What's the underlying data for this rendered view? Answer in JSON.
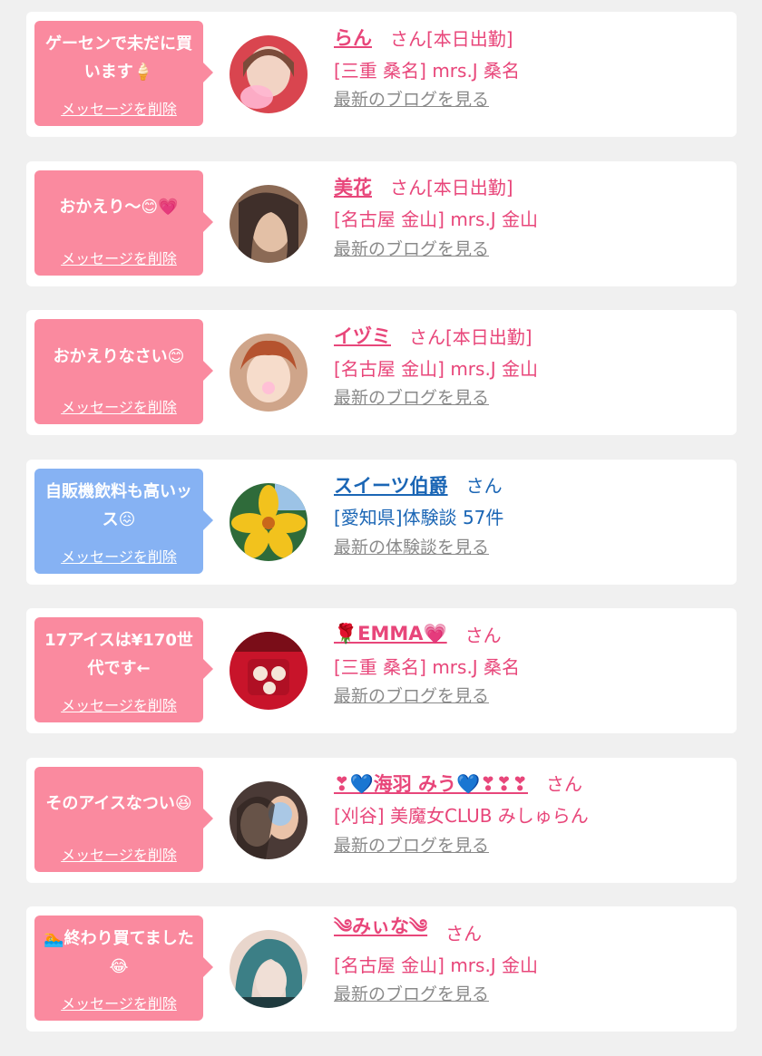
{
  "common": {
    "delete_label": "メッセージを削除"
  },
  "items": [
    {
      "theme": "pink",
      "message": "ゲーセンで未だに買います🍦",
      "name": "らん",
      "honorific": "さん[本日出勤]",
      "shop": "[三重 桑名] mrs.J 桑名",
      "link": "最新のブログを見る",
      "avatar_palette": [
        "#d9454f",
        "#f2d3c4",
        "#7b4b3a"
      ]
    },
    {
      "theme": "pink",
      "message": "おかえり〜😊💗",
      "name": "美花",
      "honorific": "さん[本日出勤]",
      "shop": "[名古屋 金山] mrs.J 金山",
      "link": "最新のブログを見る",
      "avatar_palette": [
        "#8b6a55",
        "#e3c0a6",
        "#3f2f2a"
      ]
    },
    {
      "theme": "pink",
      "message": "おかえりなさい😊",
      "name": "イヅミ",
      "honorific": "さん[本日出勤]",
      "shop": "[名古屋 金山] mrs.J 金山",
      "link": "最新のブログを見る",
      "avatar_palette": [
        "#cfa58a",
        "#f6dccb",
        "#b5532f"
      ]
    },
    {
      "theme": "blue",
      "message": "自販機飲料も高いッス😖",
      "name": "スイーツ伯爵",
      "honorific": "さん",
      "shop": "[愛知県]体験談 57件",
      "link": "最新の体験談を見る",
      "avatar_palette": [
        "#2f6b3a",
        "#f2c21d",
        "#9cc3e6"
      ]
    },
    {
      "theme": "pink",
      "message": "17アイスは¥170世代です←",
      "name": "🌹EMMA💗",
      "honorific": "さん",
      "shop": "[三重 桑名] mrs.J 桑名",
      "link": "最新のブログを見る",
      "avatar_palette": [
        "#c8142a",
        "#f5e6d8",
        "#7a0d18"
      ]
    },
    {
      "theme": "pink",
      "message": "そのアイスなつい😆",
      "name": "❣💙海羽 みう💙❣❣❣",
      "honorific": "さん",
      "shop": "[刈谷] 美魔女CLUB みしゅらん",
      "link": "最新のブログを見る",
      "avatar_palette": [
        "#4a3a36",
        "#eac3a9",
        "#9fc9f0"
      ]
    },
    {
      "theme": "pink",
      "message": "🏊終わり買てました😂",
      "name": "༄みぃな༄",
      "honorific": "さん",
      "shop": "[名古屋 金山] mrs.J 金山",
      "link": "最新のブログを見る",
      "avatar_palette": [
        "#3c7f86",
        "#e9d6cc",
        "#1f3a3e"
      ]
    }
  ]
}
